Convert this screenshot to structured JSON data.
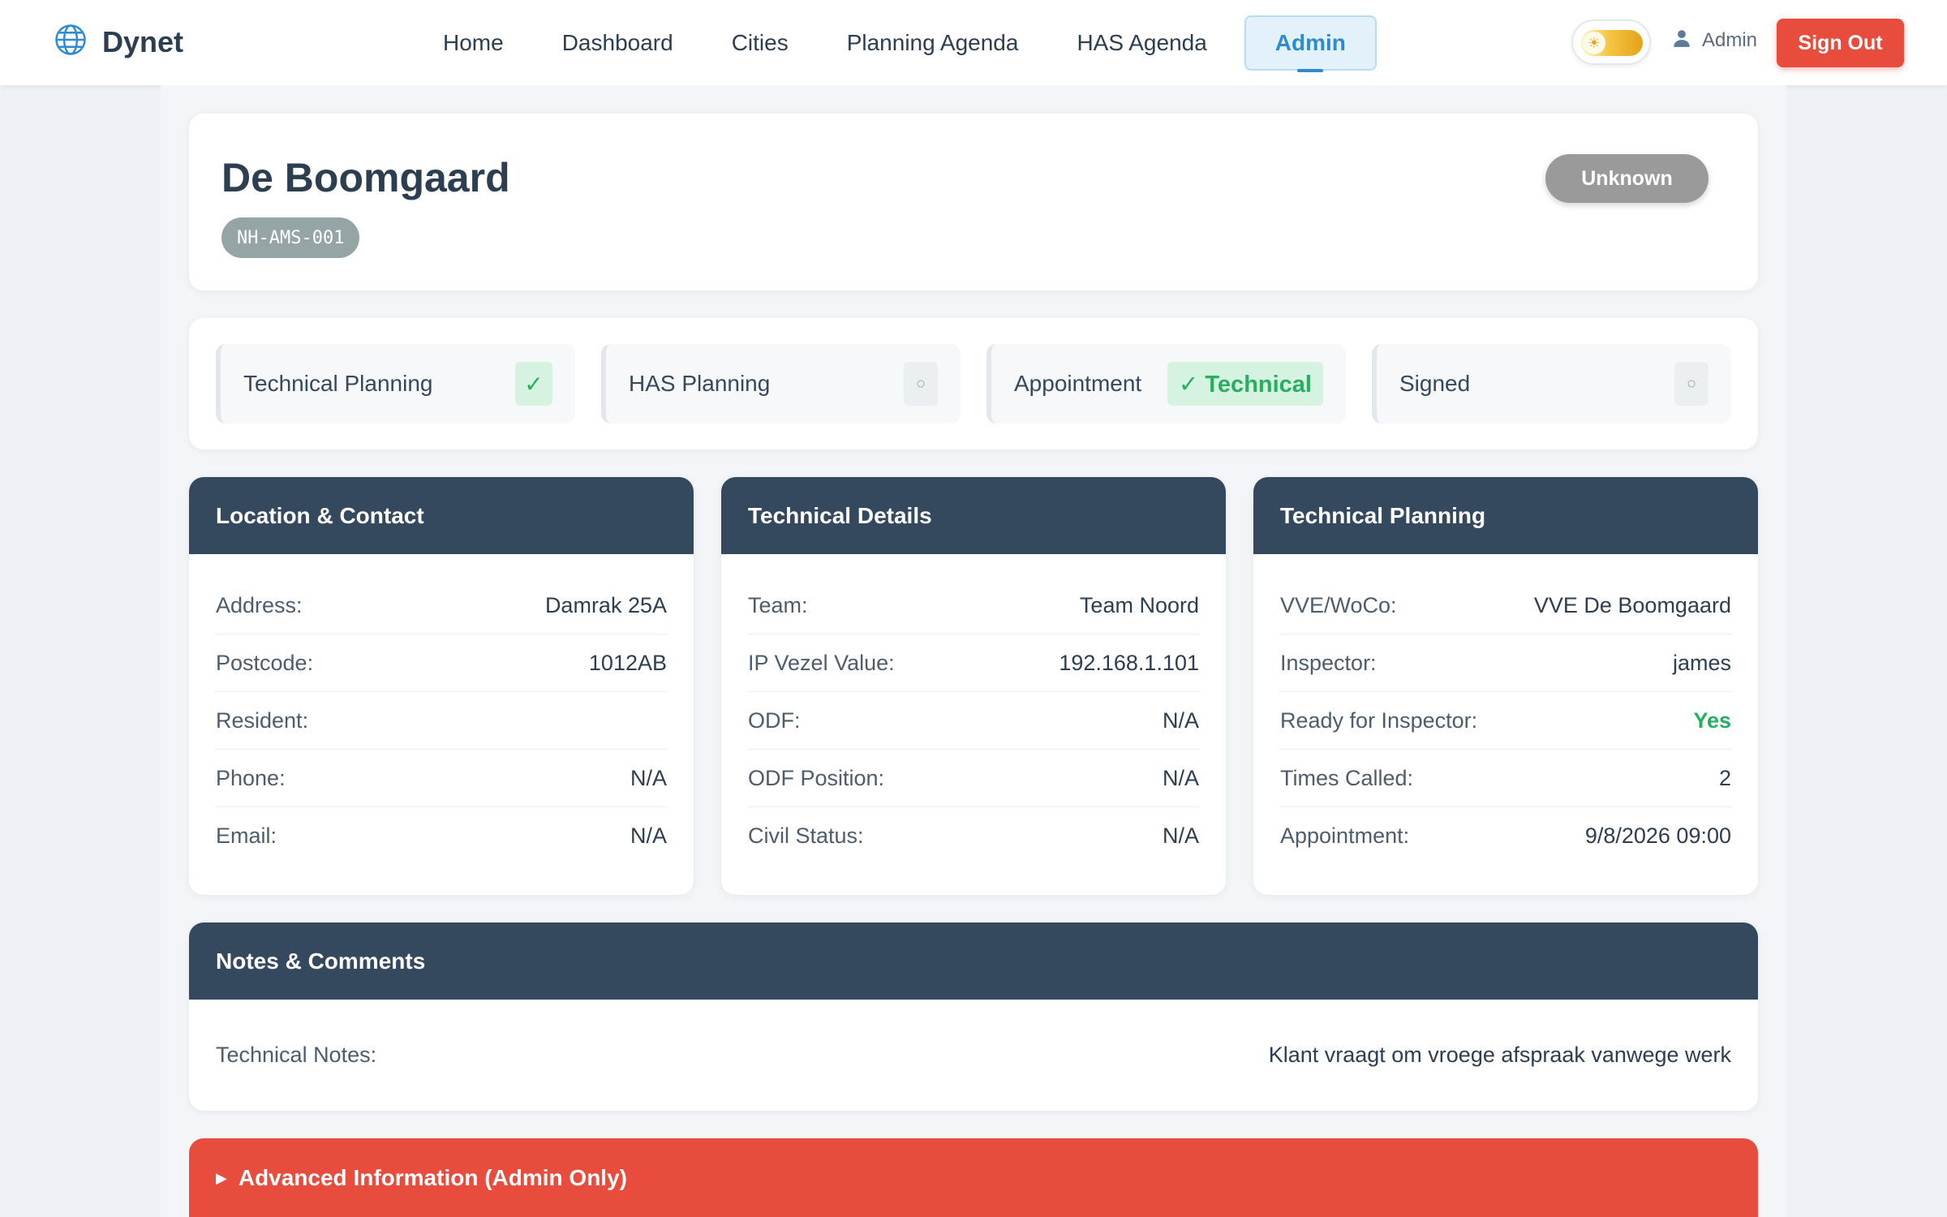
{
  "navbar": {
    "brand": "Dynet",
    "links": [
      "Home",
      "Dashboard",
      "Cities",
      "Planning Agenda",
      "HAS Agenda",
      "Admin"
    ],
    "active_link": "Admin",
    "user": "Admin",
    "signout_label": "Sign Out"
  },
  "header": {
    "title": "De Boomgaard",
    "code": "NH-AMS-001",
    "status": "Unknown"
  },
  "progress": {
    "steps": [
      {
        "label": "Technical Planning",
        "mark": "✓"
      },
      {
        "label": "HAS Planning",
        "mark": "○"
      },
      {
        "label": "Appointment",
        "mark": "✓ Technical"
      },
      {
        "label": "Signed",
        "mark": "○"
      }
    ]
  },
  "location": {
    "title": "Location & Contact",
    "rows": [
      {
        "label": "Address:",
        "value": "Damrak 25A"
      },
      {
        "label": "Postcode:",
        "value": "1012AB"
      },
      {
        "label": "Resident:",
        "value": ""
      },
      {
        "label": "Phone:",
        "value": "N/A"
      },
      {
        "label": "Email:",
        "value": "N/A"
      }
    ]
  },
  "technical_details": {
    "title": "Technical Details",
    "rows": [
      {
        "label": "Team:",
        "value": "Team Noord"
      },
      {
        "label": "IP Vezel Value:",
        "value": "192.168.1.101"
      },
      {
        "label": "ODF:",
        "value": "N/A"
      },
      {
        "label": "ODF Position:",
        "value": "N/A"
      },
      {
        "label": "Civil Status:",
        "value": "N/A"
      }
    ]
  },
  "technical_planning": {
    "title": "Technical Planning",
    "rows": [
      {
        "label": "VVE/WoCo:",
        "value": "VVE De Boomgaard"
      },
      {
        "label": "Inspector:",
        "value": "james"
      },
      {
        "label": "Ready for Inspector:",
        "value": "Yes"
      },
      {
        "label": "Times Called:",
        "value": "2"
      },
      {
        "label": "Appointment:",
        "value": "9/8/2026 09:00"
      }
    ]
  },
  "notes": {
    "title": "Notes & Comments",
    "label": "Technical Notes:",
    "value": "Klant vraagt om vroege afspraak vanwege werk"
  },
  "advanced": {
    "label": "Advanced Information (Admin Only)"
  },
  "colors": {
    "header_dark": "#34495e",
    "accent_blue": "#2f8bcf",
    "danger": "#e74c3c",
    "success": "#27ae60",
    "status_grey": "#9a9a9a"
  }
}
